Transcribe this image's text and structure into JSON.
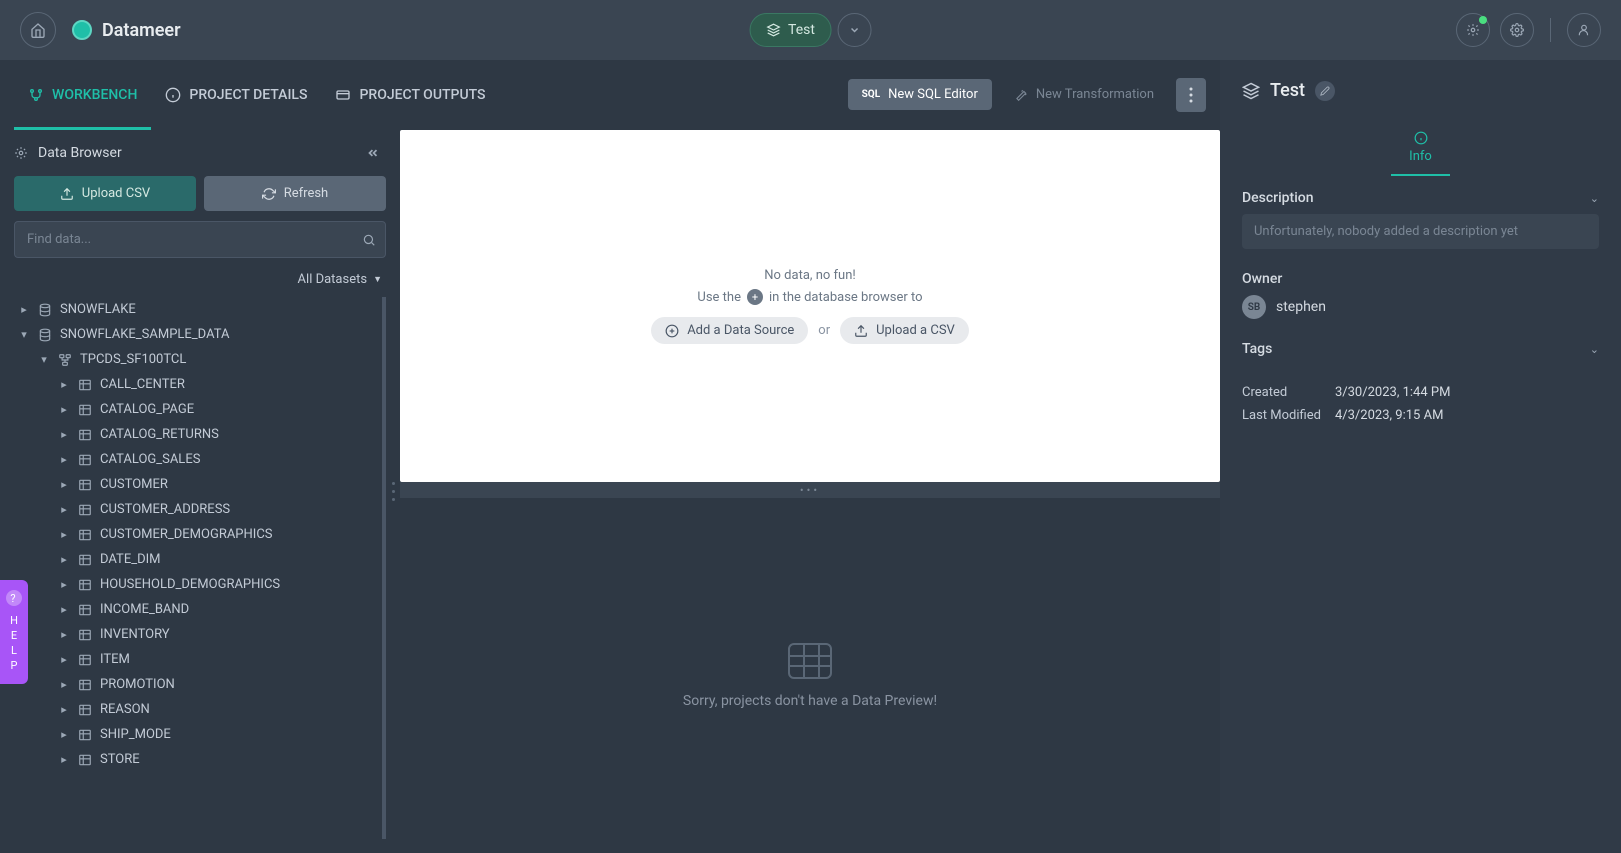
{
  "header": {
    "brand": "Datameer",
    "project_name": "Test"
  },
  "tabs": {
    "workbench": "WORKBENCH",
    "details": "PROJECT DETAILS",
    "outputs": "PROJECT OUTPUTS",
    "new_sql": "New SQL Editor",
    "new_trans": "New Transformation"
  },
  "sidebar": {
    "title": "Data Browser",
    "upload": "Upload CSV",
    "refresh": "Refresh",
    "search_placeholder": "Find data...",
    "dd_label": "All Datasets",
    "tree": [
      {
        "indent": 0,
        "chev": "right",
        "icon": "db",
        "label": "SNOWFLAKE"
      },
      {
        "indent": 0,
        "chev": "down",
        "icon": "db",
        "label": "SNOWFLAKE_SAMPLE_DATA"
      },
      {
        "indent": 1,
        "chev": "down",
        "icon": "schema",
        "label": "TPCDS_SF100TCL"
      },
      {
        "indent": 2,
        "chev": "right",
        "icon": "table",
        "label": "CALL_CENTER"
      },
      {
        "indent": 2,
        "chev": "right",
        "icon": "table",
        "label": "CATALOG_PAGE"
      },
      {
        "indent": 2,
        "chev": "right",
        "icon": "table",
        "label": "CATALOG_RETURNS"
      },
      {
        "indent": 2,
        "chev": "right",
        "icon": "table",
        "label": "CATALOG_SALES"
      },
      {
        "indent": 2,
        "chev": "right",
        "icon": "table",
        "label": "CUSTOMER"
      },
      {
        "indent": 2,
        "chev": "right",
        "icon": "table",
        "label": "CUSTOMER_ADDRESS"
      },
      {
        "indent": 2,
        "chev": "right",
        "icon": "table",
        "label": "CUSTOMER_DEMOGRAPHICS"
      },
      {
        "indent": 2,
        "chev": "right",
        "icon": "table",
        "label": "DATE_DIM"
      },
      {
        "indent": 2,
        "chev": "right",
        "icon": "table",
        "label": "HOUSEHOLD_DEMOGRAPHICS"
      },
      {
        "indent": 2,
        "chev": "right",
        "icon": "table",
        "label": "INCOME_BAND"
      },
      {
        "indent": 2,
        "chev": "right",
        "icon": "table",
        "label": "INVENTORY"
      },
      {
        "indent": 2,
        "chev": "right",
        "icon": "table",
        "label": "ITEM"
      },
      {
        "indent": 2,
        "chev": "right",
        "icon": "table",
        "label": "PROMOTION"
      },
      {
        "indent": 2,
        "chev": "right",
        "icon": "table",
        "label": "REASON"
      },
      {
        "indent": 2,
        "chev": "right",
        "icon": "table",
        "label": "SHIP_MODE"
      },
      {
        "indent": 2,
        "chev": "right",
        "icon": "table",
        "label": "STORE"
      }
    ]
  },
  "canvas": {
    "line1": "No data, no fun!",
    "line2a": "Use the",
    "line2b": "in the database browser to",
    "add_btn": "Add a Data Source",
    "or": "or",
    "upload_btn": "Upload a CSV"
  },
  "preview": {
    "text": "Sorry, projects don't have a Data Preview!"
  },
  "props": {
    "title": "Test",
    "info_tab": "Info",
    "desc_label": "Description",
    "desc_placeholder": "Unfortunately, nobody added a description yet",
    "owner_label": "Owner",
    "owner_initials": "SB",
    "owner_name": "stephen",
    "tags_label": "Tags",
    "created_label": "Created",
    "created_val": "3/30/2023, 1:44 PM",
    "modified_label": "Last Modified",
    "modified_val": "4/3/2023, 9:15 AM"
  },
  "help": "HELP"
}
